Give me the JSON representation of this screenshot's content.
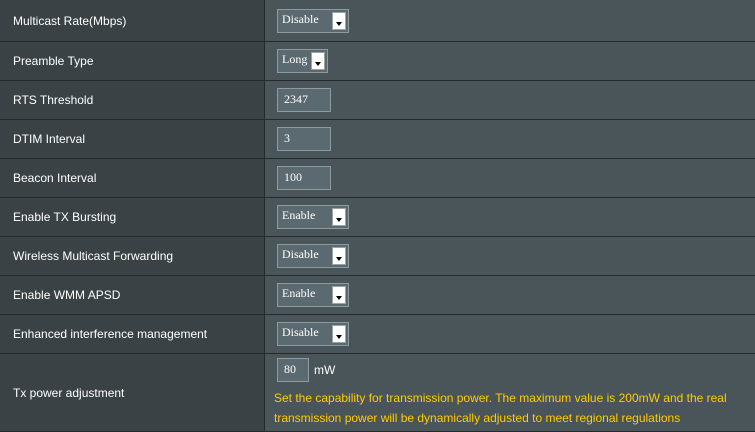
{
  "rows": [
    {
      "label": "Multicast Rate(Mbps)",
      "value": "Disable"
    },
    {
      "label": "Preamble Type",
      "value": "Long"
    },
    {
      "label": "RTS Threshold",
      "value": "2347"
    },
    {
      "label": "DTIM Interval",
      "value": "3"
    },
    {
      "label": "Beacon Interval",
      "value": "100"
    },
    {
      "label": "Enable TX Bursting",
      "value": "Enable"
    },
    {
      "label": "Wireless Multicast Forwarding",
      "value": "Disable"
    },
    {
      "label": "Enable WMM APSD",
      "value": "Enable"
    },
    {
      "label": "Enhanced interference management",
      "value": "Disable"
    },
    {
      "label": "Tx power adjustment",
      "value": "80",
      "unit": "mW",
      "note": "Set the capability for transmission power. The maximum value is 200mW and the real transmission power will be dynamically adjusted to meet regional regulations"
    }
  ],
  "colors": {
    "label_bg": "#3a4245",
    "value_bg": "#495559",
    "note_text": "#ffcc00"
  },
  "icons": {
    "select_arrow": "chevron-down-icon"
  }
}
